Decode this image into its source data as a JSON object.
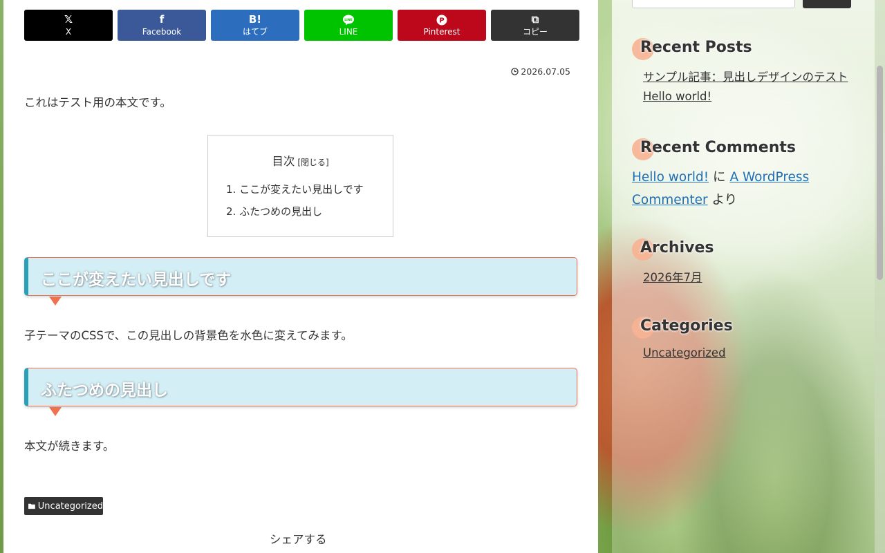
{
  "share_buttons": [
    {
      "label": "X",
      "glyph": "𝕏",
      "color": "#000000"
    },
    {
      "label": "Facebook",
      "glyph": "f",
      "color": "#3b5998"
    },
    {
      "label": "はてブ",
      "glyph": "B!",
      "color": "#2c6ebd"
    },
    {
      "label": "LINE",
      "glyph": "LINE",
      "color": "#00c300"
    },
    {
      "label": "Pinterest",
      "glyph": "P",
      "color": "#bd081c"
    },
    {
      "label": "コピー",
      "glyph": "⧉",
      "color": "#333333"
    }
  ],
  "post": {
    "date": "2026.07.05",
    "intro": "これはテスト用の本文です。",
    "toc": {
      "title": "目次",
      "toggle": "[閉じる]",
      "items": [
        "1. ここが変えたい見出しです",
        "2. ふたつめの見出し"
      ]
    },
    "heading1": "ここが変えたい見出しです",
    "para1": "子テーマのCSSで、この見出しの背景色を水色に変えてみます。",
    "heading2": "ふたつめの見出し",
    "para2": "本文が続きます。",
    "category": "Uncategorized",
    "share_label": "シェアする"
  },
  "sidebar": {
    "recent_posts": {
      "title": "Recent Posts",
      "items": [
        "サンプル記事：見出しデザインのテスト",
        "Hello world!"
      ]
    },
    "recent_comments": {
      "title": "Recent Comments",
      "post_link": "Hello world!",
      "connector": "に",
      "author_link_1": "A WordPress",
      "author_link_2": "Commenter",
      "suffix": "より"
    },
    "archives": {
      "title": "Archives",
      "items": [
        "2026年7月"
      ]
    },
    "categories": {
      "title": "Categories",
      "items": [
        "Uncategorized"
      ]
    }
  },
  "colors": {
    "heading_bg": "#d4eef6",
    "heading_accent": "#2aa0b8",
    "heading_border": "#f0704f",
    "widget_dot": "#f7b394",
    "link": "#1f6fb5"
  }
}
